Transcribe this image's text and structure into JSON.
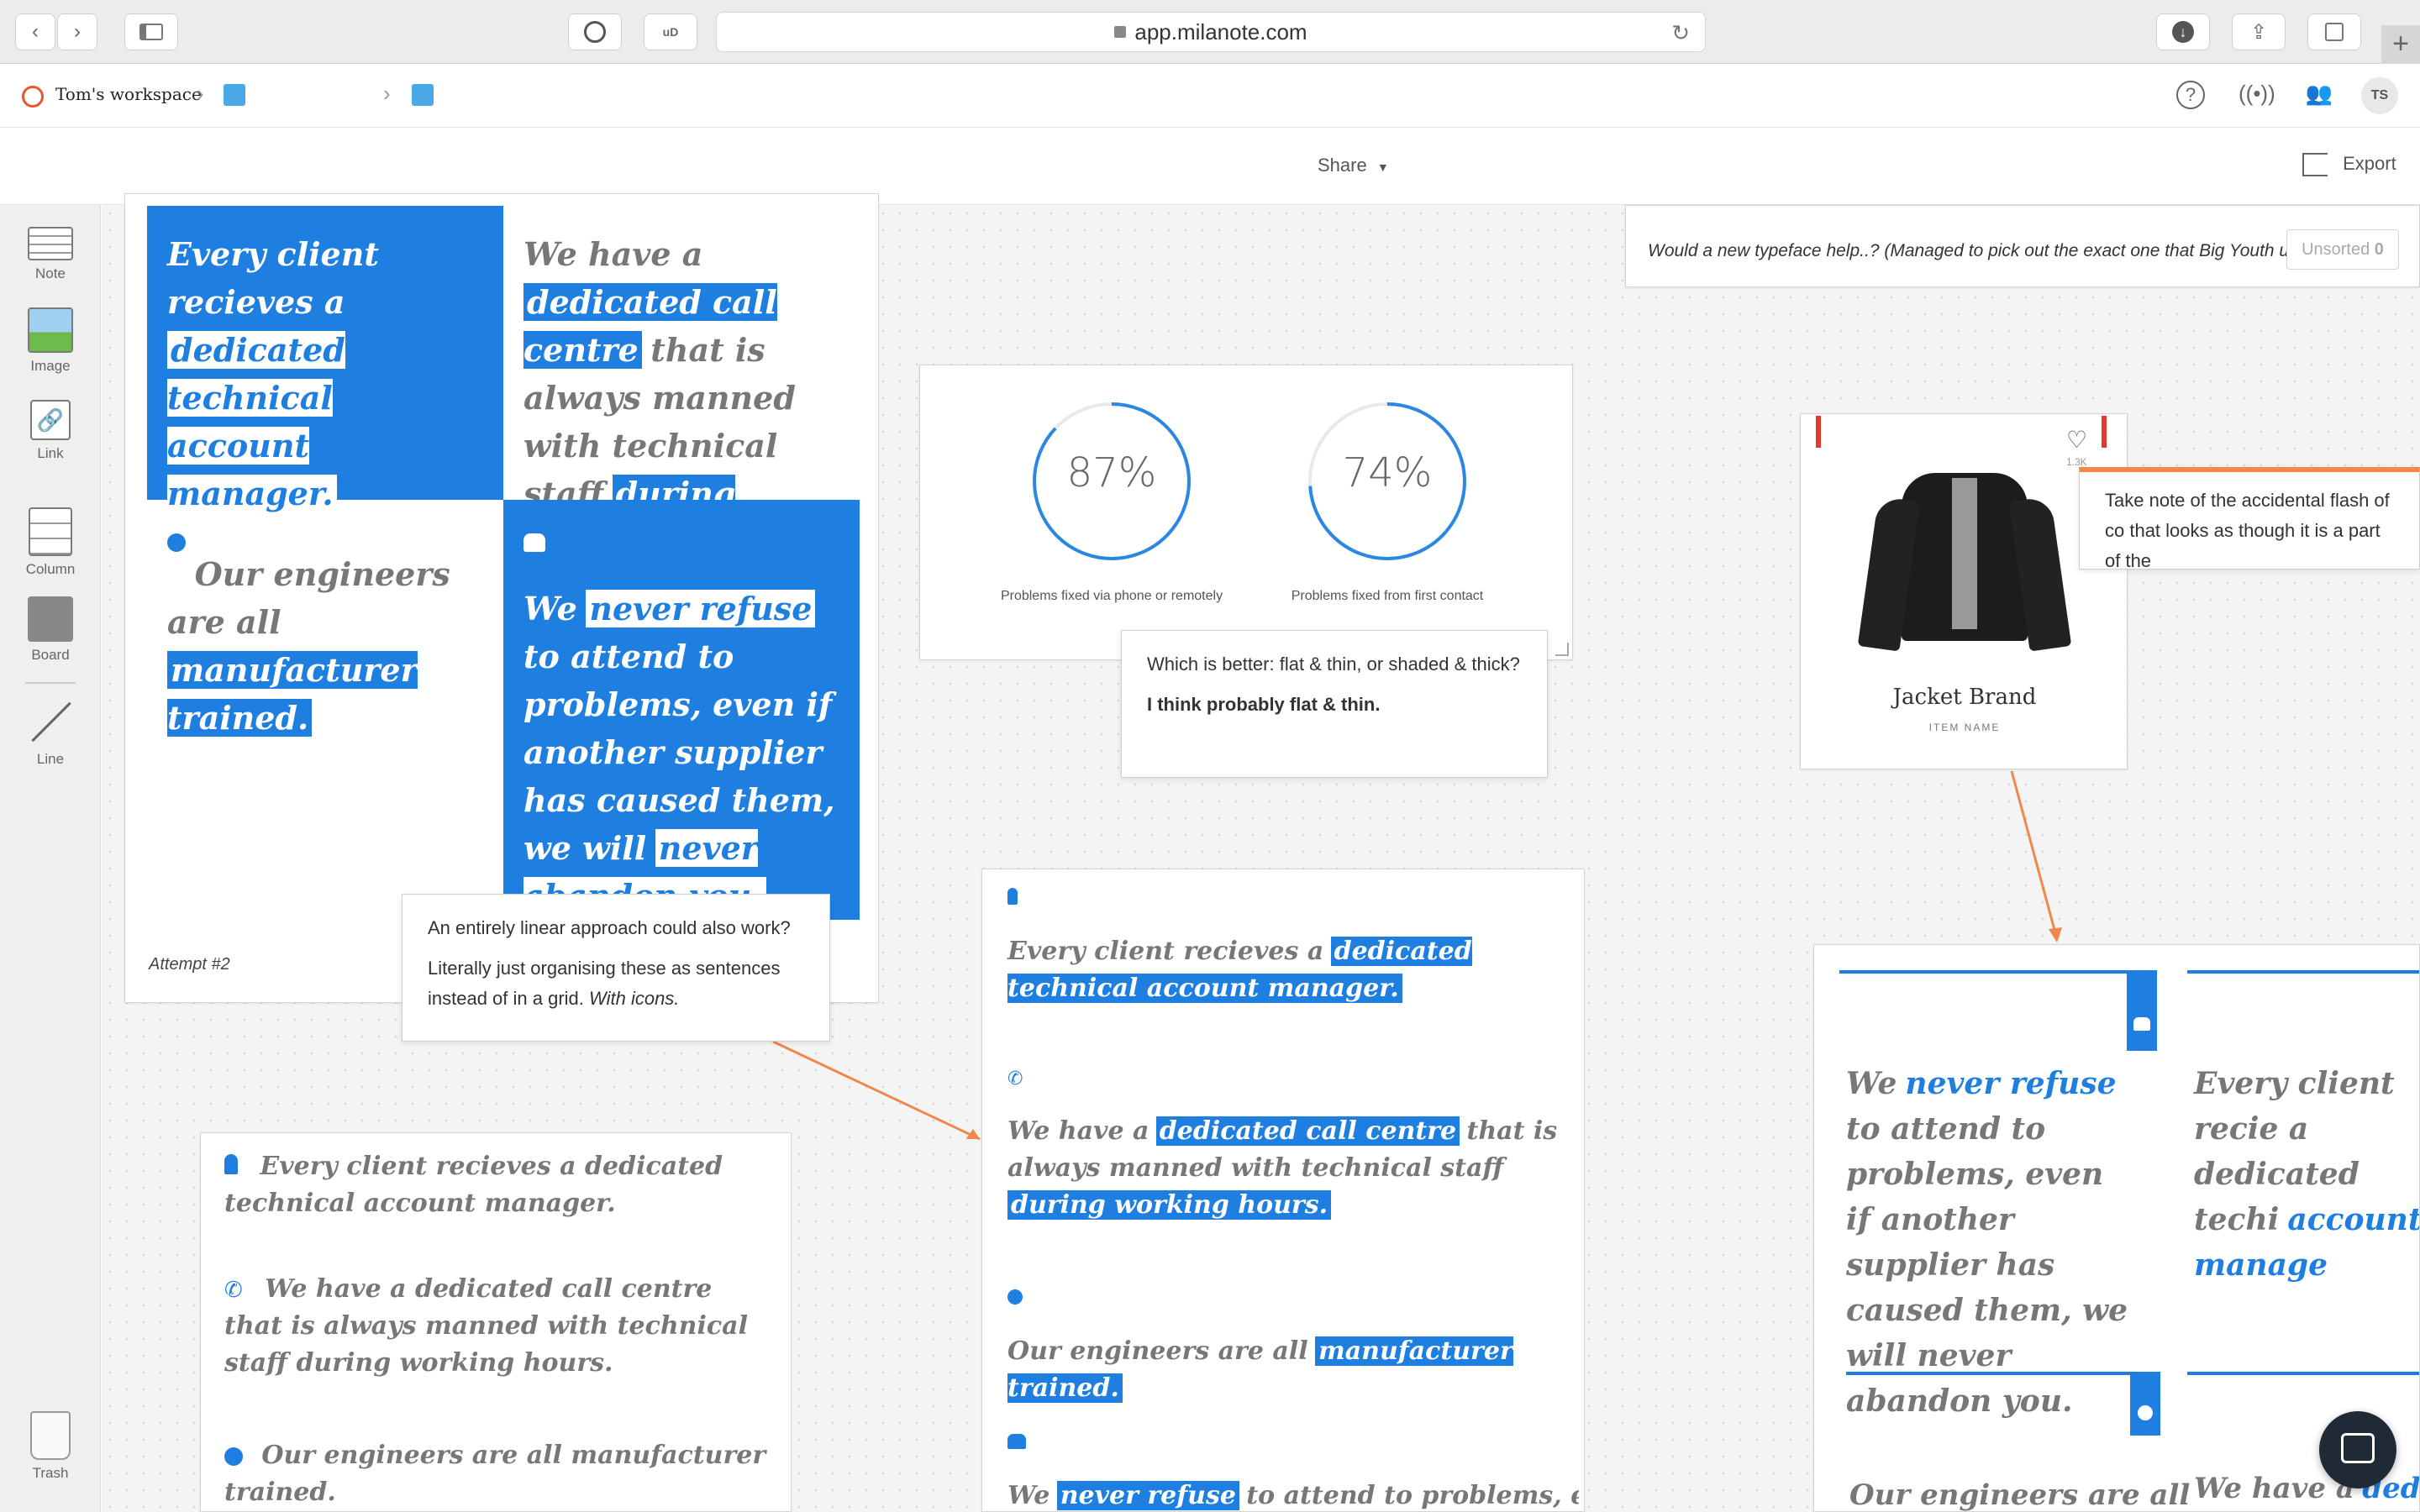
{
  "browser": {
    "url": "app.milanote.com"
  },
  "breadcrumb": {
    "workspace": "Tom's workspace",
    "separator": "›",
    "avatar_initials": "TS"
  },
  "toolbar": {
    "share_label": "Share",
    "export_label": "Export"
  },
  "sidebar": {
    "items": [
      {
        "label": "Note"
      },
      {
        "label": "Image"
      },
      {
        "label": "Link"
      },
      {
        "label": "Column"
      },
      {
        "label": "Board"
      },
      {
        "label": "Line"
      }
    ],
    "trash_label": "Trash"
  },
  "grid_card": {
    "tl_pre": "Every client recieves a",
    "tl_hl": "dedicated technical account manager.",
    "tr_pre": "We have a",
    "tr_hl1": "dedicated call centre",
    "tr_mid": "that is always manned with technical staff",
    "tr_hl2": "during working hours.",
    "bl_pre": "Our engineers are all",
    "bl_hl": "manufacturer trained.",
    "br_pre": "We",
    "br_hl1": "never refuse",
    "br_mid": "to attend to problems, even if another supplier has caused them, we will",
    "br_hl2": "never abandon you.",
    "caption": "Attempt #2"
  },
  "stats_card": {
    "stat1_value": "87%",
    "stat1_fraction": 0.87,
    "stat1_label": "Problems fixed via phone or remotely",
    "stat2_value": "74%",
    "stat2_fraction": 0.74,
    "stat2_label": "Problems fixed from first contact"
  },
  "note_flat": {
    "question": "Which is better: flat & thin, or shaded & thick?",
    "answer": "I think probably flat & thin."
  },
  "note_linear": {
    "line1": "An entirely linear approach could also work?",
    "line2": "Literally just organising these as sentences instead of in a grid.",
    "line2_em": "With icons."
  },
  "top_right_note": {
    "text": "Would a new typeface help..? (Managed to pick out the exact one that Big Youth use o",
    "unsorted_label": "Unsorted",
    "unsorted_count": "0"
  },
  "jacket_card": {
    "brand": "Jacket Brand",
    "item_name": "ITEM NAME",
    "likes": "1.3K"
  },
  "orange_note": {
    "text": "Take note of the accidental flash of co that looks as though it is a part of the"
  },
  "linear_list": {
    "item1": "Every client recieves a dedicated technical account manager.",
    "item2": "We have a dedicated call centre that is always manned with technical staff during working hours.",
    "item3": "Our engineers are all manufacturer trained."
  },
  "center_list": {
    "i1_pre": "Every client recieves a",
    "i1_hl": "dedicated technical account manager.",
    "i2_pre": "We have a",
    "i2_hl1": "dedicated call centre",
    "i2_mid": "that is always manned with technical staff",
    "i2_hl2": "during working hours.",
    "i3_pre": "Our engineers are all",
    "i3_hl": "manufacturer trained.",
    "i4_pre": "We",
    "i4_hl": "never refuse",
    "i4_post": "to attend to problems, even if"
  },
  "right_columns": {
    "c1_pre": "We",
    "c1_hl": "never refuse",
    "c1_post": "to attend to problems, even if another supplier has caused them, we will never abandon you.",
    "c2_text": "Every client recie a dedicated techi",
    "c2_hl": "account manage",
    "c3_text": "Our engineers are all",
    "c4_pre": "We have a",
    "c4_hl": "dedica"
  }
}
